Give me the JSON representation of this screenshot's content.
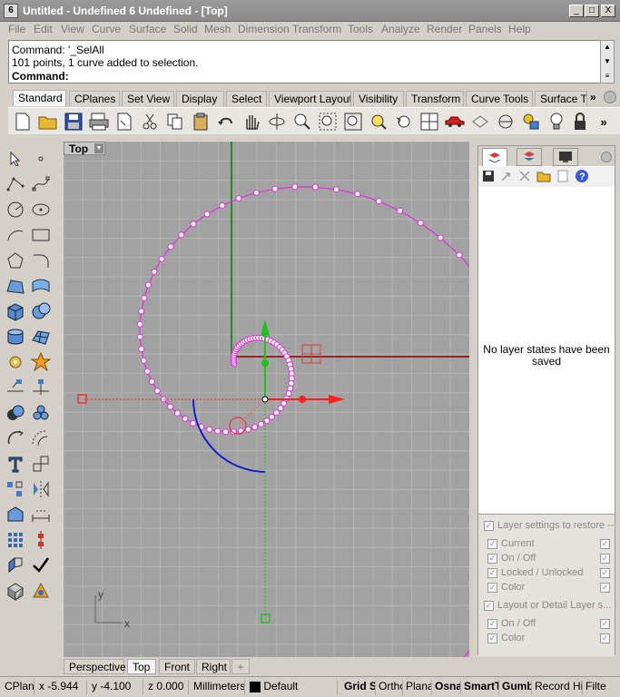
{
  "window": {
    "icon_text": "6",
    "title": "Untitled - Undefined 6 Undefined - [Top]",
    "min_label": "_",
    "max_label": "□",
    "close_label": "X"
  },
  "menu": [
    "File",
    "Edit",
    "View",
    "Curve",
    "Surface",
    "Solid",
    "Mesh",
    "Dimension",
    "Transform",
    "Tools",
    "Analyze",
    "Render",
    "Panels",
    "Help"
  ],
  "command": {
    "history": [
      "Command: '_SelAll",
      "101 points, 1 curve added to selection."
    ],
    "prompt": "Command:"
  },
  "toolbar_tabs": [
    "Standard",
    "CPlanes",
    "Set View",
    "Display",
    "Select",
    "Viewport Layout",
    "Visibility",
    "Transform",
    "Curve Tools",
    "Surface Tc"
  ],
  "toolbar_more": "»",
  "viewport": {
    "name": "Top",
    "dropdown": "▼",
    "axis_x": "x",
    "axis_y": "y"
  },
  "viewport_tabs": [
    "Perspective",
    "Top",
    "Front",
    "Right"
  ],
  "viewport_add": "+",
  "layer_panel": {
    "empty_message": "No layer states have been saved",
    "settings_header": "Layer settings to restore --",
    "settings_items": [
      "Current",
      "On / Off",
      "Locked / Unlocked",
      "Color"
    ],
    "layout_header": "Layout or Detail Layer s...",
    "layout_items": [
      "On / Off",
      "Color"
    ]
  },
  "status": {
    "cplane": "CPlane",
    "x": "x -5.944",
    "y": "y -4.100",
    "z": "z 0.000",
    "units": "Millimeters",
    "layer": "Default",
    "grid_snap": "Grid Sn",
    "ortho": "Ortho",
    "planar": "Planar",
    "osnap": "Osna",
    "smarttrack": "SmartT",
    "gumball": "Gumb",
    "record_history": "Record Hist",
    "filter": "Filte"
  },
  "colors": {
    "curve": "#e030e0",
    "x_axis": "#8b0000",
    "y_axis": "#008000",
    "gumball_x": "#ff2020",
    "gumball_y": "#20c020",
    "arc": "#1010d0"
  }
}
